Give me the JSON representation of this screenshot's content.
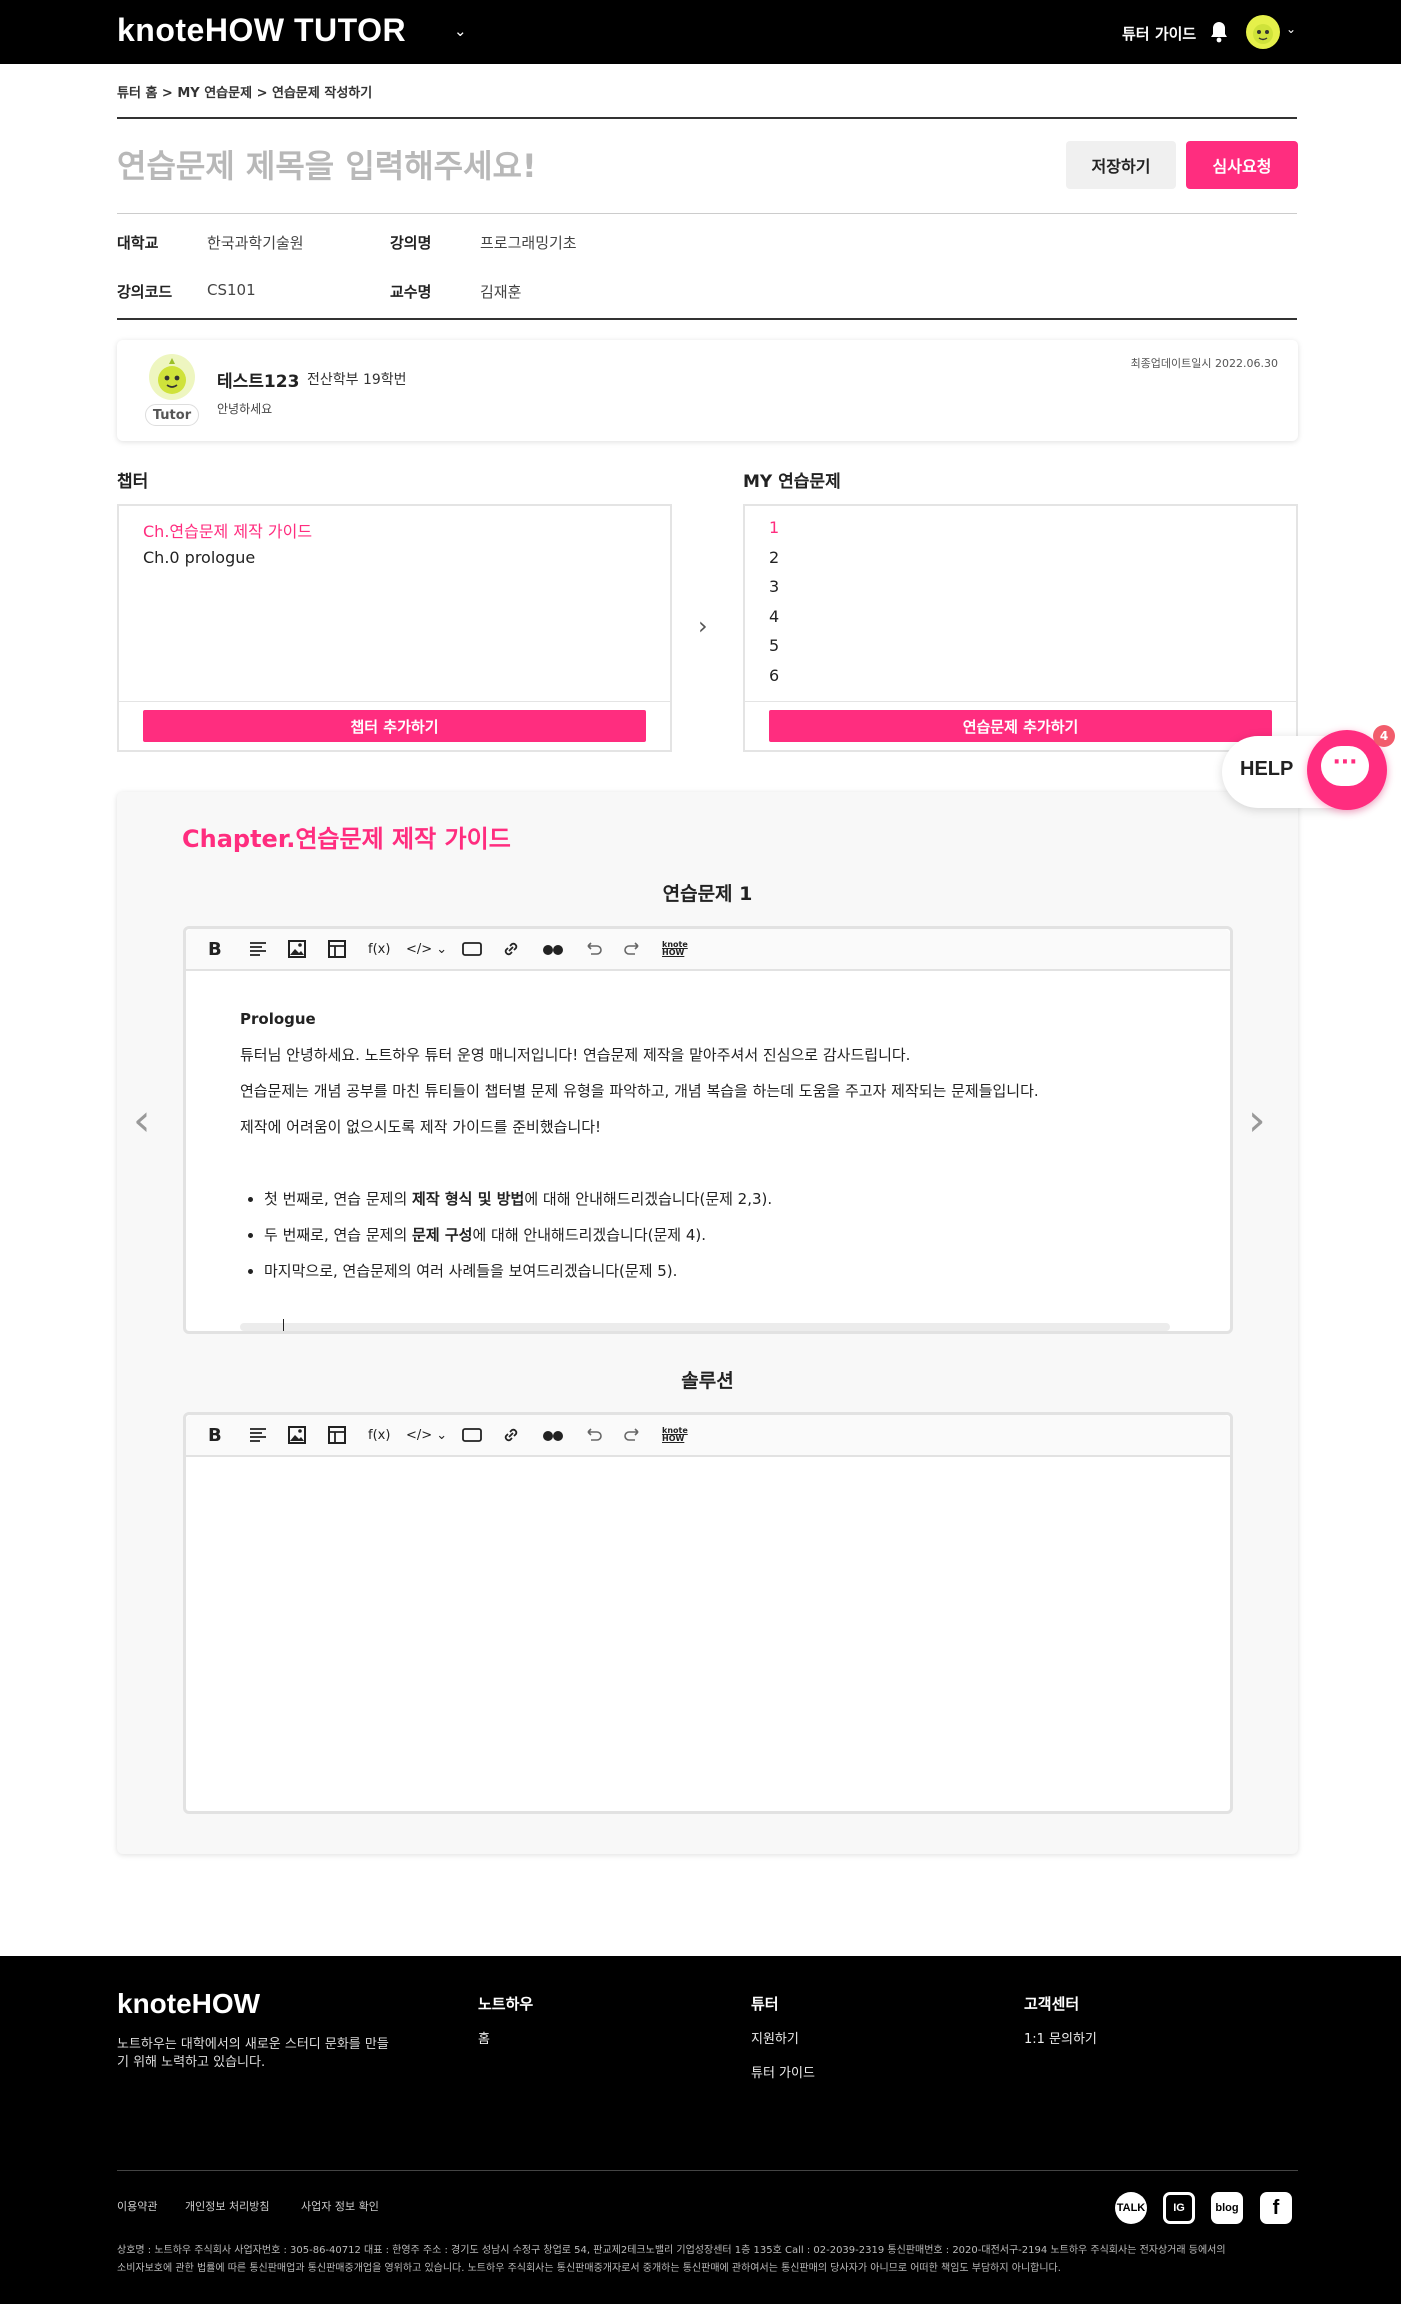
{
  "header": {
    "brand": "knoteHOW TUTOR",
    "guide_link": "튜터 가이드"
  },
  "breadcrumb": "튜터 홈 > MY 연습문제 > 연습문제 작성하기",
  "title": {
    "placeholder": "연습문제 제목을 입력해주세요!",
    "save_label": "저장하기",
    "review_label": "심사요청"
  },
  "meta": {
    "university_label": "대학교",
    "university": "한국과학기술원",
    "lecture_label": "강의명",
    "lecture": "프로그래밍기초",
    "code_label": "강의코드",
    "code": "CS101",
    "professor_label": "교수명",
    "professor": "김재훈"
  },
  "tutor": {
    "badge": "Tutor",
    "name": "테스트123",
    "dept": "전산학부 19학번",
    "greeting": "안녕하세요",
    "updated": "최종업데이트일시 2022.06.30"
  },
  "chapters": {
    "title": "챕터",
    "items": [
      "Ch.연습문제 제작 가이드",
      "Ch.0 prologue"
    ],
    "add_label": "챕터 추가하기",
    "active_color": "#ff2d7f"
  },
  "exercises": {
    "title": "MY 연습문제",
    "items": [
      "1",
      "2",
      "3",
      "4",
      "5",
      "6"
    ],
    "add_label": "연습문제 추가하기"
  },
  "help": {
    "label": "HELP",
    "count": "4"
  },
  "editor": {
    "chapter_title": "Chapter.연습문제 제작 가이드",
    "problem_title": "연습문제 1",
    "toolbar_icons": [
      "bold-icon",
      "align-icon",
      "image-icon",
      "table-icon",
      "formula-icon",
      "code-icon",
      "box-icon",
      "link-icon",
      "quote-icon",
      "undo-icon",
      "redo-icon",
      "knotehow-icon"
    ],
    "formula_label": "f(x)",
    "code_label": "</>",
    "logo_label": "knote HOW",
    "content": {
      "heading": "Prologue",
      "p1": "튜터님 안녕하세요. 노트하우 튜터 운영 매니저입니다! 연습문제 제작을 맡아주셔서 진심으로 감사드립니다.",
      "p2": "연습문제는 개념 공부를 마친 튜티들이 챕터별 문제 유형을 파악하고, 개념 복습을 하는데 도움을 주고자 제작되는 문제들입니다.",
      "p3": "제작에 어려움이 없으시도록 제작 가이드를 준비했습니다!",
      "bullet1_a": "첫 번째로, 연습 문제의 ",
      "bullet1_b": "제작 형식 및 방법",
      "bullet1_c": "에 대해 안내해드리겠습니다(문제 2,3).",
      "bullet2_a": "두 번째로, 연습 문제의 ",
      "bullet2_b": "문제 구성",
      "bullet2_c": "에 대해 안내해드리겠습니다(문제 4).",
      "bullet3": "마지막으로, 연습문제의 여러 사례들을 보여드리겠습니다(문제 5)."
    },
    "solution_title": "솔루션"
  },
  "footer": {
    "brand": "knoteHOW",
    "desc": "노트하우는 대학에서의 새로운 스터디 문화를 만들기 위해 노력하고 있습니다.",
    "col1_title": "노트하우",
    "col1_items": [
      "홈"
    ],
    "col2_title": "튜터",
    "col2_items": [
      "지원하기",
      "튜터 가이드"
    ],
    "col3_title": "고객센터",
    "col3_items": [
      "1:1 문의하기"
    ],
    "bottom_links": [
      "이용약관",
      "개인정보 처리방침",
      "사업자 정보 확인"
    ],
    "social": [
      "TALK",
      "IG",
      "blog",
      "f"
    ],
    "legal_1": "상호명 : 노트하우 주식회사 사업자번호 : 305-86-40712 대표 : 한영주 주소 : 경기도 성남시 수정구 창업로 54, 판교제2테크노밸리 기업성장센터 1층 135호 Call : 02-2039-2319 통신판매번호 : 2020-대전서구-2194 노트하우 주식회사는 전자상거래 등에서의",
    "legal_2": "소비자보호에 관한 법률에 따른 통신판매업과 통신판매중개업을 영위하고 있습니다. 노트하우 주식회사는 통신판매중개자로서 중개하는 통신판매에 관하여서는 통신판매의 당사자가 아니므로 어떠한 책임도 부담하지 아니합니다."
  }
}
